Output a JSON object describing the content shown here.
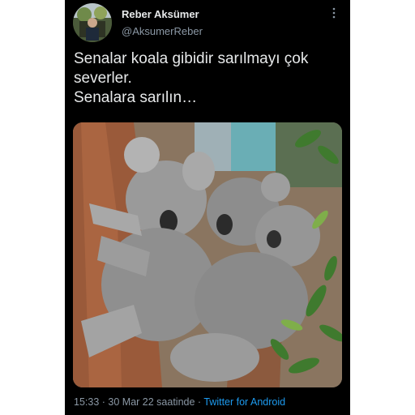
{
  "user": {
    "name": "Reber Aksümer",
    "handle": "@AksumerReber"
  },
  "tweet": {
    "lines": [
      "Senalar koala gibidir sarılmayı çok",
      "severler.",
      "Senalara sarılın…"
    ]
  },
  "meta": {
    "time": "15:33",
    "separator": "·",
    "date": "30 Mar 22 saatinde",
    "source": "Twitter for Android"
  },
  "icons": {
    "more": "more-vertical-icon"
  },
  "colors": {
    "background": "#000000",
    "text": "#e7e9ea",
    "secondary": "#8b98a5",
    "link": "#1d9bf0"
  }
}
